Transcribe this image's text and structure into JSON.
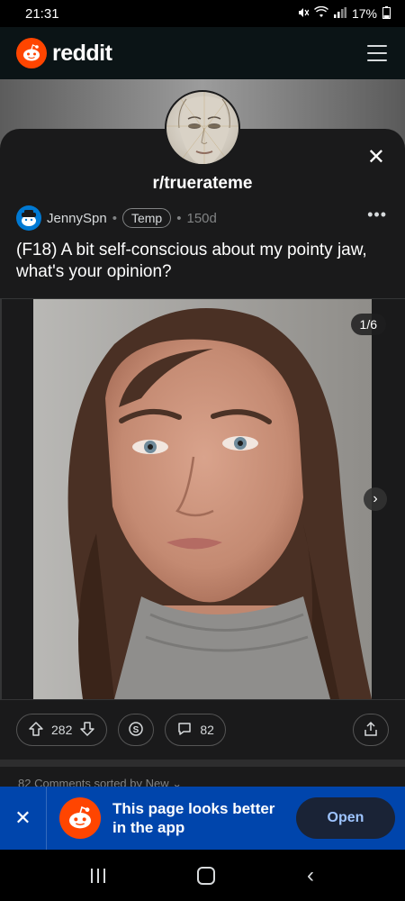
{
  "status_bar": {
    "time": "21:31",
    "battery": "17%",
    "icons": [
      "mute-icon",
      "wifi-icon",
      "signal-icon",
      "battery-icon"
    ]
  },
  "header": {
    "brand": "reddit",
    "menu_icon": "hamburger-icon"
  },
  "post": {
    "subreddit": "r/truerateme",
    "author": "JennySpn",
    "flair": "Temp",
    "age": "150d",
    "title": "(F18) A bit self-conscious about my pointy jaw, what's your opinion?",
    "gallery_counter": "1/6",
    "votes": "282",
    "comments": "82"
  },
  "comments_section": {
    "peek_text": "82 Comments sorted by New ⌄"
  },
  "app_banner": {
    "message": "This page looks better in the app",
    "open_label": "Open"
  },
  "colors": {
    "reddit_orange": "#ff4500",
    "banner_blue": "#0045ac",
    "sheet_bg": "#1a1a1b"
  }
}
